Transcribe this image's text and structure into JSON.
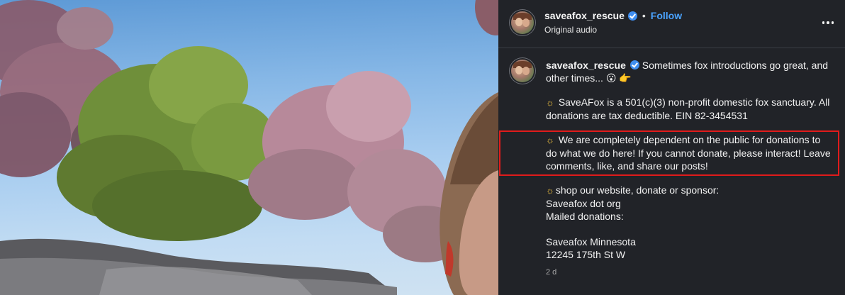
{
  "header": {
    "username": "saveafox_rescue",
    "separator": "•",
    "follow_label": "Follow",
    "audio_label": "Original audio",
    "more_icon": "more-horizontal-icon"
  },
  "caption": {
    "username": "saveafox_rescue",
    "intro": "Sometimes fox introductions go great, and other times...",
    "intro_emoji": "😮 👉",
    "sun_glyph": "☼",
    "para_nonprofit": "SaveAFox is a 501(c)(3) non-profit domestic fox sanctuary. All donations are tax deductible. EIN 82-3454531",
    "para_dependent": "We are completely dependent on the public for donations to do what we do here! If you cannot donate, please interact! Leave comments, like, and share our posts!",
    "shop_line": "shop our website, donate or sponsor:",
    "website": "Saveafox dot org",
    "mailed": "Mailed donations:",
    "org_name": "Saveafox Minnesota",
    "street": "12245 175th St W"
  },
  "timestamp": "2 d",
  "colors": {
    "panel_bg": "#212328",
    "follow_blue": "#4aa3ff",
    "verified_blue": "#3f8ef0",
    "highlight_red": "#e01b1b"
  }
}
